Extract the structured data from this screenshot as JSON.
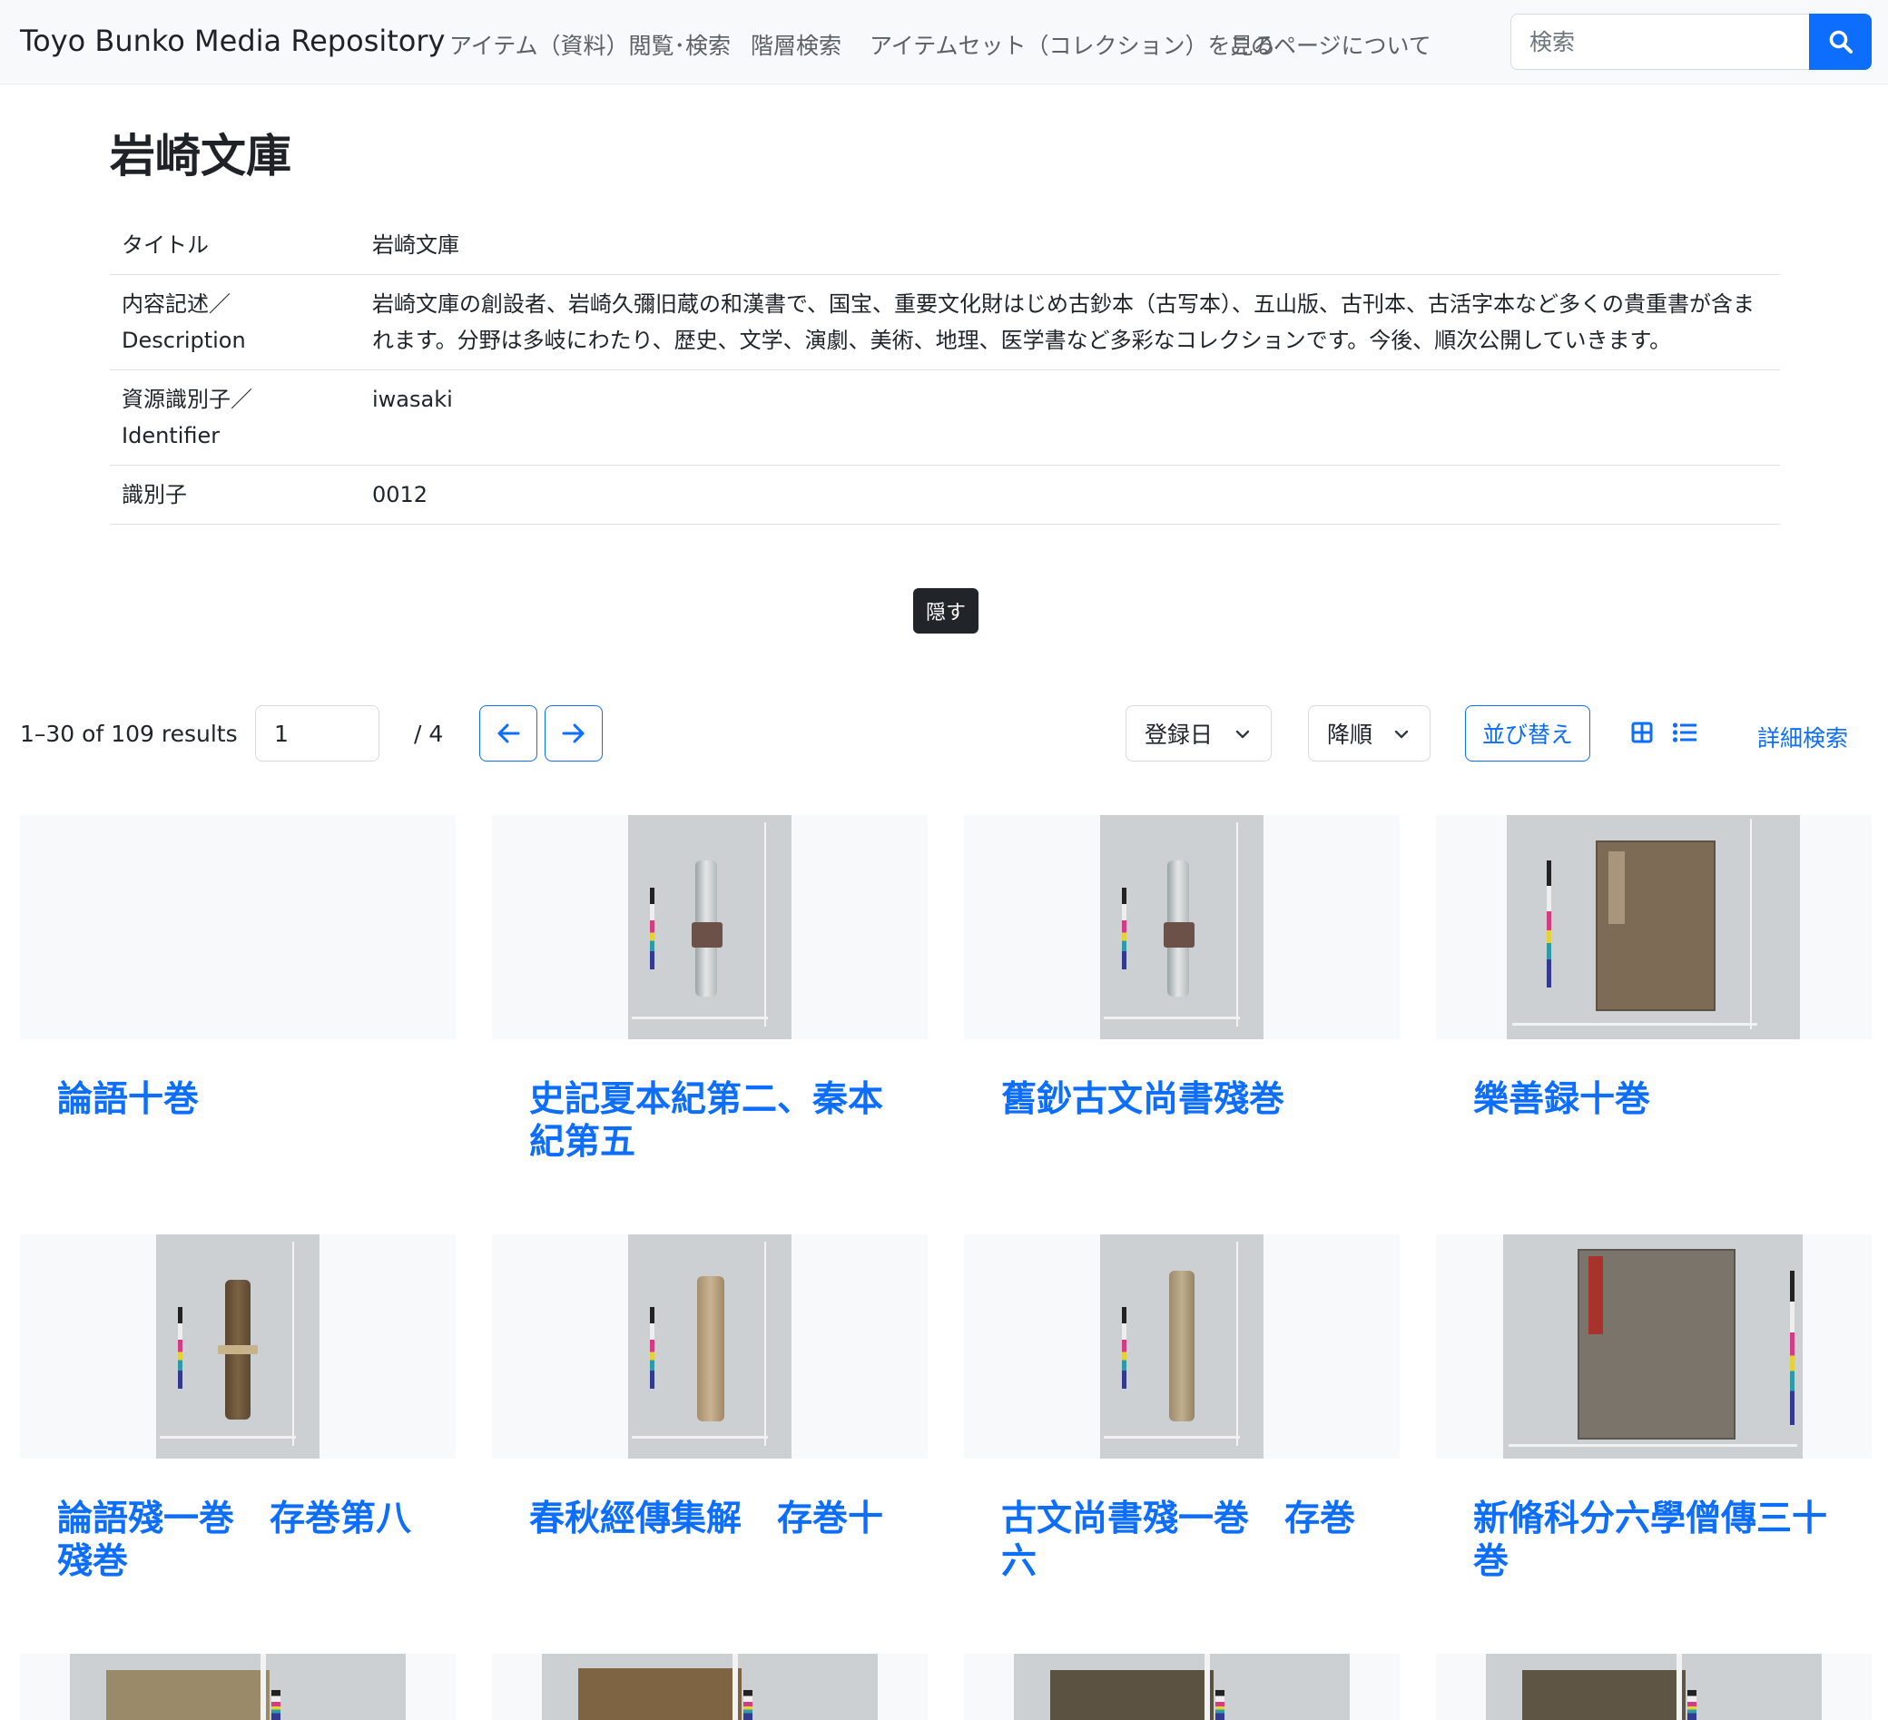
{
  "navbar": {
    "brand": "Toyo Bunko Media Repository",
    "links": [
      "アイテム（資料）閲覧･検索",
      "階層検索",
      "アイテムセット（コレクション）を見る",
      "このページについて"
    ],
    "search_placeholder": "検索"
  },
  "collection": {
    "title": "岩崎文庫",
    "metadata": [
      {
        "label": "タイトル",
        "value": "岩崎文庫"
      },
      {
        "label": "内容記述／Description",
        "value": "岩崎文庫の創設者、岩崎久彌旧蔵の和漢書で、国宝、重要文化財はじめ古鈔本（古写本）、五山版、古刊本、古活字本など多くの貴重書が含まれます。分野は多岐にわたり、歴史、文学、演劇、美術、地理、医学書など多彩なコレクションです。今後、順次公開していきます。"
      },
      {
        "label": "資源識別子／Identifier",
        "value": "iwasaki"
      },
      {
        "label": "識別子",
        "value": "0012"
      }
    ],
    "hide_label": "隠す"
  },
  "toolbar": {
    "results": "1–30 of 109 results",
    "page_value": "1",
    "page_total": "/ 4",
    "sort_field": "登録日",
    "sort_order": "降順",
    "sort_button": "並び替え",
    "advanced_search": "詳細検索"
  },
  "items": [
    {
      "title": "論語十巻"
    },
    {
      "title": "史記夏本紀第二、秦本紀第五"
    },
    {
      "title": "舊鈔古文尚書殘巻"
    },
    {
      "title": "樂善録十巻"
    },
    {
      "title": "論語殘一巻　存巻第八殘巻"
    },
    {
      "title": "春秋經傳集解　存巻十"
    },
    {
      "title": "古文尚書殘一巻　存巻六"
    },
    {
      "title": "新脩科分六學僧傳三十巻"
    }
  ]
}
